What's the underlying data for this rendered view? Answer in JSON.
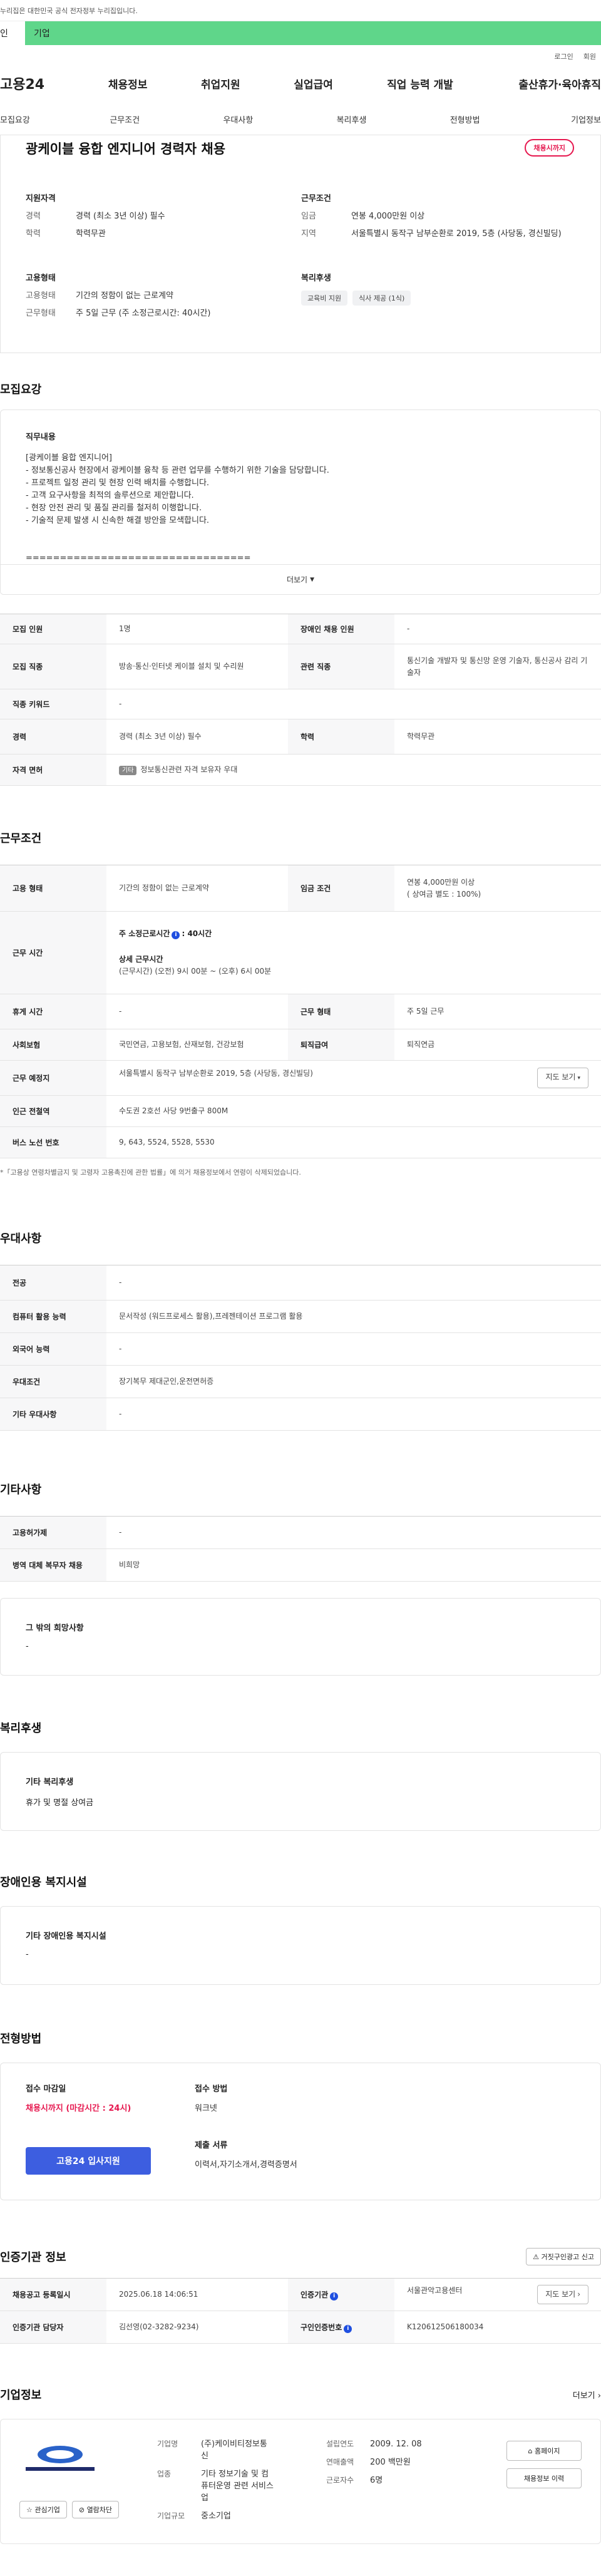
{
  "gov_banner": "누리집은 대한민국 공식 전자정부 누리집입니다.",
  "user_tabs": [
    "인",
    "기업"
  ],
  "util": [
    "로그인",
    "회원"
  ],
  "logo": "고용24",
  "gnb": [
    "채용정보",
    "취업지원",
    "실업급여",
    "직업 능력 개발",
    "출산휴가·육아휴직"
  ],
  "subnav": [
    "모집요강",
    "근무조건",
    "우대사항",
    "복리후생",
    "전형방법",
    "기업정보"
  ],
  "summary": {
    "title": "광케이블 융합 엔지니어 경력자 채용",
    "badge": "채용시까지",
    "qual_title": "지원자격",
    "qual": [
      {
        "k": "경력",
        "v": "경력 (최소 3년 이상) 필수"
      },
      {
        "k": "학력",
        "v": "학력무관"
      }
    ],
    "cond_title": "근무조건",
    "cond": [
      {
        "k": "임금",
        "v": "연봉 4,000만원 이상"
      },
      {
        "k": "지역",
        "v": "서울특별시 동작구 남부순환로 2019, 5층 (사당동, 경신빌딩)"
      }
    ],
    "emp_title": "고용형태",
    "emp": [
      {
        "k": "고용형태",
        "v": "기간의 정함이 없는 근로계약"
      },
      {
        "k": "근무형태",
        "v": "주 5일 근무 (주 소정근로시간: 40시간)"
      }
    ],
    "welfare_title": "복리후생",
    "welfare_chips": [
      "교육비 지원",
      "식사 제공 (1식)"
    ]
  },
  "recruit": {
    "title": "모집요강",
    "desc_title": "직무내용",
    "desc": "[광케이블 융합 엔지니어]\n- 정보통신공사 현장에서 광케이블 융착 등 관련 업무를 수행하기 위한 기술을 담당합니다.\n- 프로젝트 일정 관리 및 현장 인력 배치를 수행합니다.\n- 고객 요구사항을 최적의 솔루션으로 제안합니다.\n- 현장 안전 관리 및 품질 관리를 철저히 이행합니다.\n- 기술적 문제 발생 시 신속한 해결 방안을 모색합니다.\n\n\n=================================",
    "more": "더보기",
    "rows": [
      {
        "k1": "모집 인원",
        "v1": "1명",
        "k2": "장애인 채용 인원",
        "v2": "-"
      },
      {
        "k1": "모집 직종",
        "v1": "방송·통신·인터넷 케이블 설치 및 수리원",
        "k2": "관련 직종",
        "v2": "통신기술 개발자 및 통신망 운영 기술자, 통신공사 감리 기술자"
      },
      {
        "k1": "직종 키워드",
        "v1": "-"
      },
      {
        "k1": "경력",
        "v1": "경력 (최소 3년 이상) 필수",
        "k2": "학력",
        "v2": "학력무관"
      },
      {
        "k1": "자격 면허",
        "tag": "기타",
        "v1": "정보통신관련 자격 보유자 우대"
      }
    ]
  },
  "work": {
    "title": "근무조건",
    "emp_type_k": "고용 형태",
    "emp_type_v": "기간의 정함이 없는 근로계약",
    "wage_k": "임금 조건",
    "wage_v1": "연봉 4,000만원 이상",
    "wage_v2": "( 상여금 별도 : 100%)",
    "time_k": "근무 시간",
    "time_hours_label": "주 소정근로시간",
    "time_hours_badge": "i",
    "time_hours_val": ": 40시간",
    "time_detail_title": "상세 근무시간",
    "time_detail": "(근무시간) (오전) 9시 00분 ~ (오후) 6시 00분",
    "rest_k": "휴게 시간",
    "rest_v": "-",
    "shape_k": "근무 형태",
    "shape_v": "주 5일 근무",
    "ins_k": "사회보험",
    "ins_v": "국민연금, 고용보험, 산재보험, 건강보험",
    "ret_k": "퇴직급여",
    "ret_v": "퇴직연금",
    "place_k": "근무 예정지",
    "place_v": "서울특별시 동작구 남부순환로 2019, 5층 (사당동, 경신빌딩)",
    "map_btn": "지도 보기",
    "subway_k": "인근 전철역",
    "subway_v": "수도권 2호선 사당 9번출구 800M",
    "bus_k": "버스 노선 번호",
    "bus_v": "9, 643, 5524, 5528, 5530",
    "note": "*「고용상 연령차별금지 및 고령자 고용촉진에 관한 법률」에 의거 채용정보에서 연령이 삭제되었습니다."
  },
  "pref": {
    "title": "우대사항",
    "rows": [
      {
        "k": "전공",
        "v": "-"
      },
      {
        "k": "컴퓨터 활용 능력",
        "v": "문서작성 (워드프로세스 활용),프레젠테이션 프로그램 활용"
      },
      {
        "k": "외국어 능력",
        "v": "-"
      },
      {
        "k": "우대조건",
        "v": "장기복무 제대군인,운전면허증"
      },
      {
        "k": "기타 우대사항",
        "v": "-"
      }
    ]
  },
  "etc": {
    "title": "기타사항",
    "rows": [
      {
        "k": "고용허가제",
        "v": "-"
      },
      {
        "k": "병역 대체 복무자 채용",
        "v": "비희망"
      }
    ],
    "hope_title": "그 밖의 희망사항",
    "hope_v": "-"
  },
  "welfare": {
    "title": "복리후생",
    "box_title": "기타 복리후생",
    "box_v": "휴가 및 명절 상여금"
  },
  "disab": {
    "title": "장애인용 복지시설",
    "box_title": "기타 장애인용 복지시설",
    "box_v": "-"
  },
  "method": {
    "title": "전형방법",
    "deadline_title": "접수 마감일",
    "deadline_v": "채용시까지 (마감시간 : 24시)",
    "apply_btn": "고용24 입사지원",
    "how_title": "접수 방법",
    "how_v": "워크넷",
    "docs_title": "제출 서류",
    "docs_v": "이력서,자기소개서,경력증명서"
  },
  "agency": {
    "title": "인증기관 정보",
    "report_btn": "거짓구인광고 신고",
    "reg_k": "채용공고 등록일시",
    "reg_v": "2025.06.18 14:06:51",
    "cert_k": "인증기관",
    "cert_v": "서울관악고용센터",
    "map_btn": "지도 보기",
    "staff_k": "인증기관 담당자",
    "staff_v": "김선영(02-3282-9234)",
    "no_k": "구인인증번호",
    "no_v": "K120612506180034"
  },
  "company": {
    "title": "기업정보",
    "more": "더보기",
    "logo_text": "(주)케이비티정보통신",
    "btn_interest": "관심기업",
    "btn_block": "열람차단",
    "name_k": "기업명",
    "name_v": "(주)케이비티정보통신",
    "biz_k": "업종",
    "biz_v": "기타 정보기술 및 컴퓨터운영 관련 서비스업",
    "size_k": "기업규모",
    "size_v": "중소기업",
    "est_k": "설립연도",
    "est_v": "2009. 12. 08",
    "rev_k": "연매출액",
    "rev_v": "200 백만원",
    "emp_k": "근로자수",
    "emp_v": "6명",
    "homepage_btn": "홈페이지",
    "jobs_btn": "채용정보 이력"
  },
  "colors": {
    "accent": "#3d5ee0",
    "red": "#e6184f",
    "green": "#5fd68a"
  }
}
